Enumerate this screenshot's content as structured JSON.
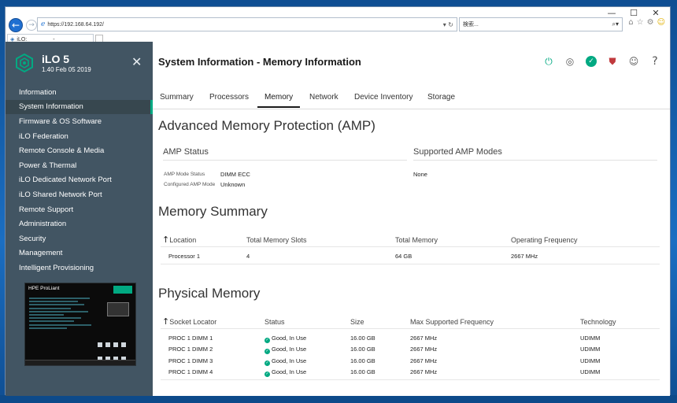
{
  "browser": {
    "url": "https://192.168.64.192/",
    "search_placeholder": "検索...",
    "tab_title": "iLO:",
    "tab_title_suffix": "-"
  },
  "window_controls": {
    "minimize": "—",
    "maximize": "☐",
    "close": "✕"
  },
  "sidebar": {
    "brand_name": "iLO 5",
    "brand_version": "1.40 Feb 05 2019",
    "items": [
      {
        "label": "Information"
      },
      {
        "label": "System Information"
      },
      {
        "label": "Firmware & OS Software"
      },
      {
        "label": "iLO Federation"
      },
      {
        "label": "Remote Console & Media"
      },
      {
        "label": "Power & Thermal"
      },
      {
        "label": "iLO Dedicated Network Port"
      },
      {
        "label": "iLO Shared Network Port"
      },
      {
        "label": "Remote Support"
      },
      {
        "label": "Administration"
      },
      {
        "label": "Security"
      },
      {
        "label": "Management"
      },
      {
        "label": "Intelligent Provisioning"
      }
    ],
    "active_index": 1,
    "thumbnail_title": "HPE ProLiant"
  },
  "main": {
    "page_title": "System Information - Memory Information",
    "tabs": [
      {
        "label": "Summary"
      },
      {
        "label": "Processors"
      },
      {
        "label": "Memory"
      },
      {
        "label": "Network"
      },
      {
        "label": "Device Inventory"
      },
      {
        "label": "Storage"
      }
    ],
    "active_tab": 2
  },
  "amp": {
    "heading": "Advanced Memory Protection (AMP)",
    "status_label": "AMP Status",
    "modes_label": "Supported AMP Modes",
    "mode_status_key": "AMP Mode Status",
    "mode_status_value": "DIMM ECC",
    "configured_key": "Configured AMP Mode",
    "configured_value": "Unknown",
    "supported_modes_value": "None"
  },
  "memory_summary": {
    "heading": "Memory Summary",
    "columns": [
      "Location",
      "Total Memory Slots",
      "Total Memory",
      "Operating Frequency"
    ],
    "rows": [
      [
        "Processor 1",
        "4",
        "64 GB",
        "2667 MHz"
      ]
    ]
  },
  "physical_memory": {
    "heading": "Physical Memory",
    "columns": [
      "Socket Locator",
      "Status",
      "Size",
      "Max Supported Frequency",
      "Technology"
    ],
    "rows": [
      [
        "PROC 1 DIMM 1",
        "Good, In Use",
        "16.00 GB",
        "2667 MHz",
        "UDIMM"
      ],
      [
        "PROC 1 DIMM 2",
        "Good, In Use",
        "16.00 GB",
        "2667 MHz",
        "UDIMM"
      ],
      [
        "PROC 1 DIMM 3",
        "Good, In Use",
        "16.00 GB",
        "2667 MHz",
        "UDIMM"
      ],
      [
        "PROC 1 DIMM 4",
        "Good, In Use",
        "16.00 GB",
        "2667 MHz",
        "UDIMM"
      ]
    ]
  },
  "colors": {
    "hpe_green": "#01a982",
    "sidebar_bg": "#425563",
    "alert_red": "#c0393d"
  }
}
